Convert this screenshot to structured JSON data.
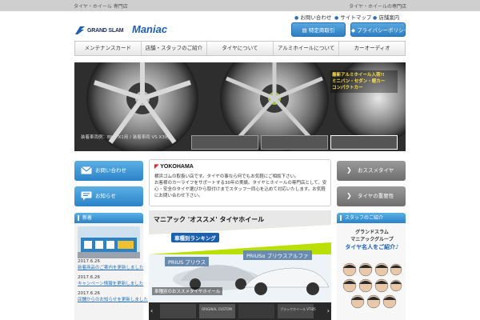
{
  "topbar": {
    "left": "タイヤ・ホイール 専門店",
    "right": "タイヤ・ホイールの専門店"
  },
  "brand": {
    "line1": "GRAND SLAM",
    "line2": "Maniac",
    "accent": "#1b5fb3"
  },
  "utility_links": [
    {
      "label": "お問い合わせ",
      "icon": "arrow-icon"
    },
    {
      "label": "サイトマップ",
      "icon": "arrow-icon"
    },
    {
      "label": "店舗案内",
      "icon": "arrow-icon"
    }
  ],
  "header_buttons": {
    "law": "特定商取引",
    "privacy": "プライバシーポリシー"
  },
  "nav": [
    "メンテナンスカード",
    "店舗・スタッフのご紹介",
    "タイヤについて",
    "アルミホイールについて",
    "カーオーディオ"
  ],
  "hero": {
    "caption": "装着車両例：BMP X1用 / 装着車両 VS X3用",
    "promo": [
      "最新アルミホイール入荷!!",
      "ミニバン・セダン・軽カー",
      "コンパクトカー"
    ]
  },
  "side_left": {
    "contact": "お問い合わせ",
    "news": "お知らせ"
  },
  "side_right": {
    "recommend": "おススメタイヤ",
    "importance": "タイヤの重要性"
  },
  "yokohama": {
    "logo": "YOKOHAMA",
    "text1": "横浜ゴムの取扱い店です。タイヤの事なら何でもお気軽にご相談下さい。",
    "text2": "お客様のカーライフをサポートする30年の実績。タイヤとホイールの専門店として、安心・安全のタイヤ選びから取付けまでスタッフ一同心を込めて対応いたします。お気軽にお問い合わせ下さい。"
  },
  "news_panel": {
    "title": "新着",
    "items": [
      {
        "date": "2017.6.26",
        "title": "新着商品のご案内を更新しました"
      },
      {
        "date": "2017.6.26",
        "title": "キャンペーン情報を更新しました"
      },
      {
        "date": "2017.6.26",
        "title": "店舗からのお知らせを更新しました"
      }
    ]
  },
  "feature": {
    "tagline": "マニアック 'オススメ' タイヤホイール",
    "ranking": "車種別ランキング",
    "car1": "PRIUS プリウス",
    "car2": "PRIUSα プリウスアルファ",
    "caption": "車種別のおススメタイヤホイール",
    "strip": [
      "ORIGINAL CUSTOM",
      "ブラックホイール VT-B5"
    ]
  },
  "staff_panel": {
    "title": "スタッフのご紹介",
    "line1": "グランドスラム",
    "line2": "マニアックグループ",
    "line3": "タイヤ名人をご紹介♪"
  }
}
